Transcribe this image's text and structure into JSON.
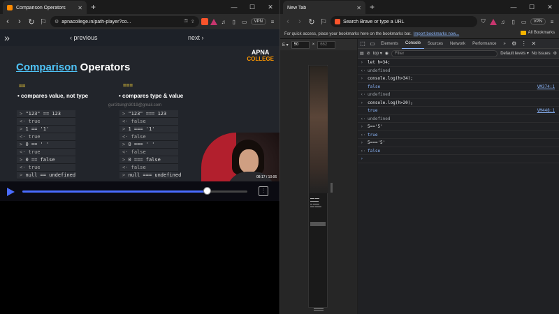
{
  "left": {
    "tab_title": "Comparison Operators",
    "url": "apnacollege.in/path-player?co...",
    "vpn_label": "VPN",
    "nav_prev": "‹ previous",
    "nav_next": "next ›",
    "slide": {
      "title_hl": "Comparison",
      "title_rest": " Operators",
      "logo_line1": "APNA",
      "logo_line2": "COLLEGE",
      "op1": "==",
      "op2": "===",
      "bullet1": "• compares value, not type",
      "bullet2": "• compares type & value",
      "watermark": "guri3tsingh3019@gmail.com",
      "box1": [
        {
          "p": ">",
          "t": "\"123\" == 123"
        },
        {
          "p": "<·",
          "t": "true"
        },
        {
          "p": ">",
          "t": "1 == '1'"
        },
        {
          "p": "<·",
          "t": "true"
        },
        {
          "p": ">",
          "t": "0 == ' '"
        },
        {
          "p": "<·",
          "t": "true"
        },
        {
          "p": ">",
          "t": "0 == false"
        },
        {
          "p": "<·",
          "t": "true"
        },
        {
          "p": ">",
          "t": "null == undefined"
        }
      ],
      "box2": [
        {
          "p": ">",
          "t": "\"123\" === 123"
        },
        {
          "p": "<·",
          "t": "false"
        },
        {
          "p": ">",
          "t": "1 === '1'"
        },
        {
          "p": "<·",
          "t": "false"
        },
        {
          "p": ">",
          "t": "0 === ' '"
        },
        {
          "p": "<·",
          "t": "false"
        },
        {
          "p": ">",
          "t": "0 === false"
        },
        {
          "p": "<·",
          "t": "false"
        },
        {
          "p": ">",
          "t": "null === undefined"
        }
      ]
    },
    "video_time": "08:17 / 10:06",
    "progress": 0.82
  },
  "right": {
    "tab_title": "New Tab",
    "omnibox_placeholder": "Search Brave or type a URL",
    "vpn_label": "VPN",
    "bookmarks_msg": "For quick access, place your bookmarks here on the bookmarks bar.",
    "bookmarks_link": "Import bookmarks now...",
    "all_bookmarks": "All Bookmarks",
    "emu": {
      "device": "E ▾",
      "w": "50",
      "x": "×",
      "h": "662"
    },
    "devtools_tabs": [
      "Elements",
      "Console",
      "Sources",
      "Network",
      "Performance",
      "»"
    ],
    "context": "top ▾",
    "filter_placeholder": "Filter",
    "levels": "Default levels ▾",
    "issues": "No Issues",
    "console": [
      {
        "k": "in",
        "t": "let h=34;"
      },
      {
        "k": "ret",
        "t": "undefined"
      },
      {
        "k": "in",
        "t": "console.log(h>34);"
      },
      {
        "k": "log",
        "t": "false",
        "src": "VM374:1"
      },
      {
        "k": "ret",
        "t": "undefined"
      },
      {
        "k": "in",
        "t": "console.log(h>20);"
      },
      {
        "k": "log",
        "t": "true",
        "src": "VM448:1"
      },
      {
        "k": "ret",
        "t": "undefined"
      },
      {
        "k": "in",
        "t": "5=='5'"
      },
      {
        "k": "retb",
        "t": "true"
      },
      {
        "k": "in",
        "t": "5==='5'"
      },
      {
        "k": "retb",
        "t": "false"
      },
      {
        "k": "prompt",
        "t": ""
      }
    ]
  },
  "colors": {
    "accent": "#4a6cff",
    "title_hl": "#4fc3f7",
    "op": "#f5d33b"
  }
}
